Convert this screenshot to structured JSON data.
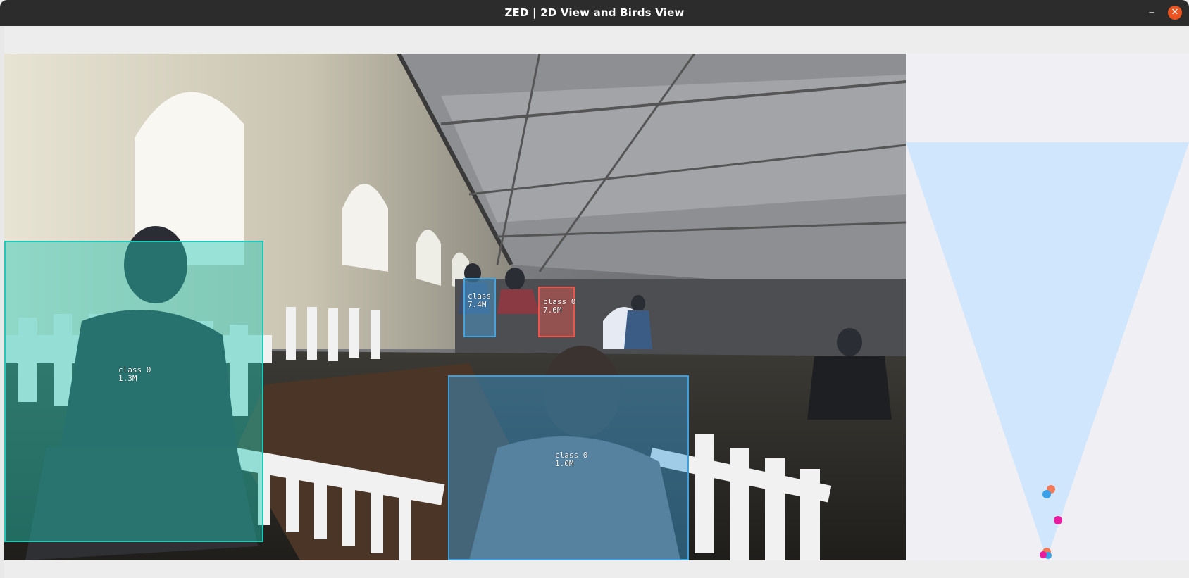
{
  "window": {
    "title": "ZED | 2D View and Birds View",
    "minimize_symbol": "–",
    "close_symbol": "✕"
  },
  "detections": [
    {
      "class_label": "class 0",
      "distance": "1.3M",
      "color": "#23c7b5"
    },
    {
      "class_label": "class 0",
      "distance": "1.0M",
      "color": "#3d9fdc"
    },
    {
      "class_label": "class 0",
      "distance": "7.6M",
      "color": "#e8574c"
    },
    {
      "class_label": "class",
      "distance": "7.4M",
      "color": "#46a3dc"
    }
  ],
  "birds_view": {
    "fov_color": "#cfe6fd",
    "background": "#efeff4",
    "points": [
      {
        "color": "#f07a5a"
      },
      {
        "color": "#3aa0e8"
      },
      {
        "color": "#e91c9f"
      },
      {
        "color": "#f07a5a"
      },
      {
        "color": "#3aa0e8"
      },
      {
        "color": "#e91c9f"
      }
    ]
  },
  "icons": [
    "camera-feed-image",
    "minimize-icon",
    "close-icon"
  ]
}
